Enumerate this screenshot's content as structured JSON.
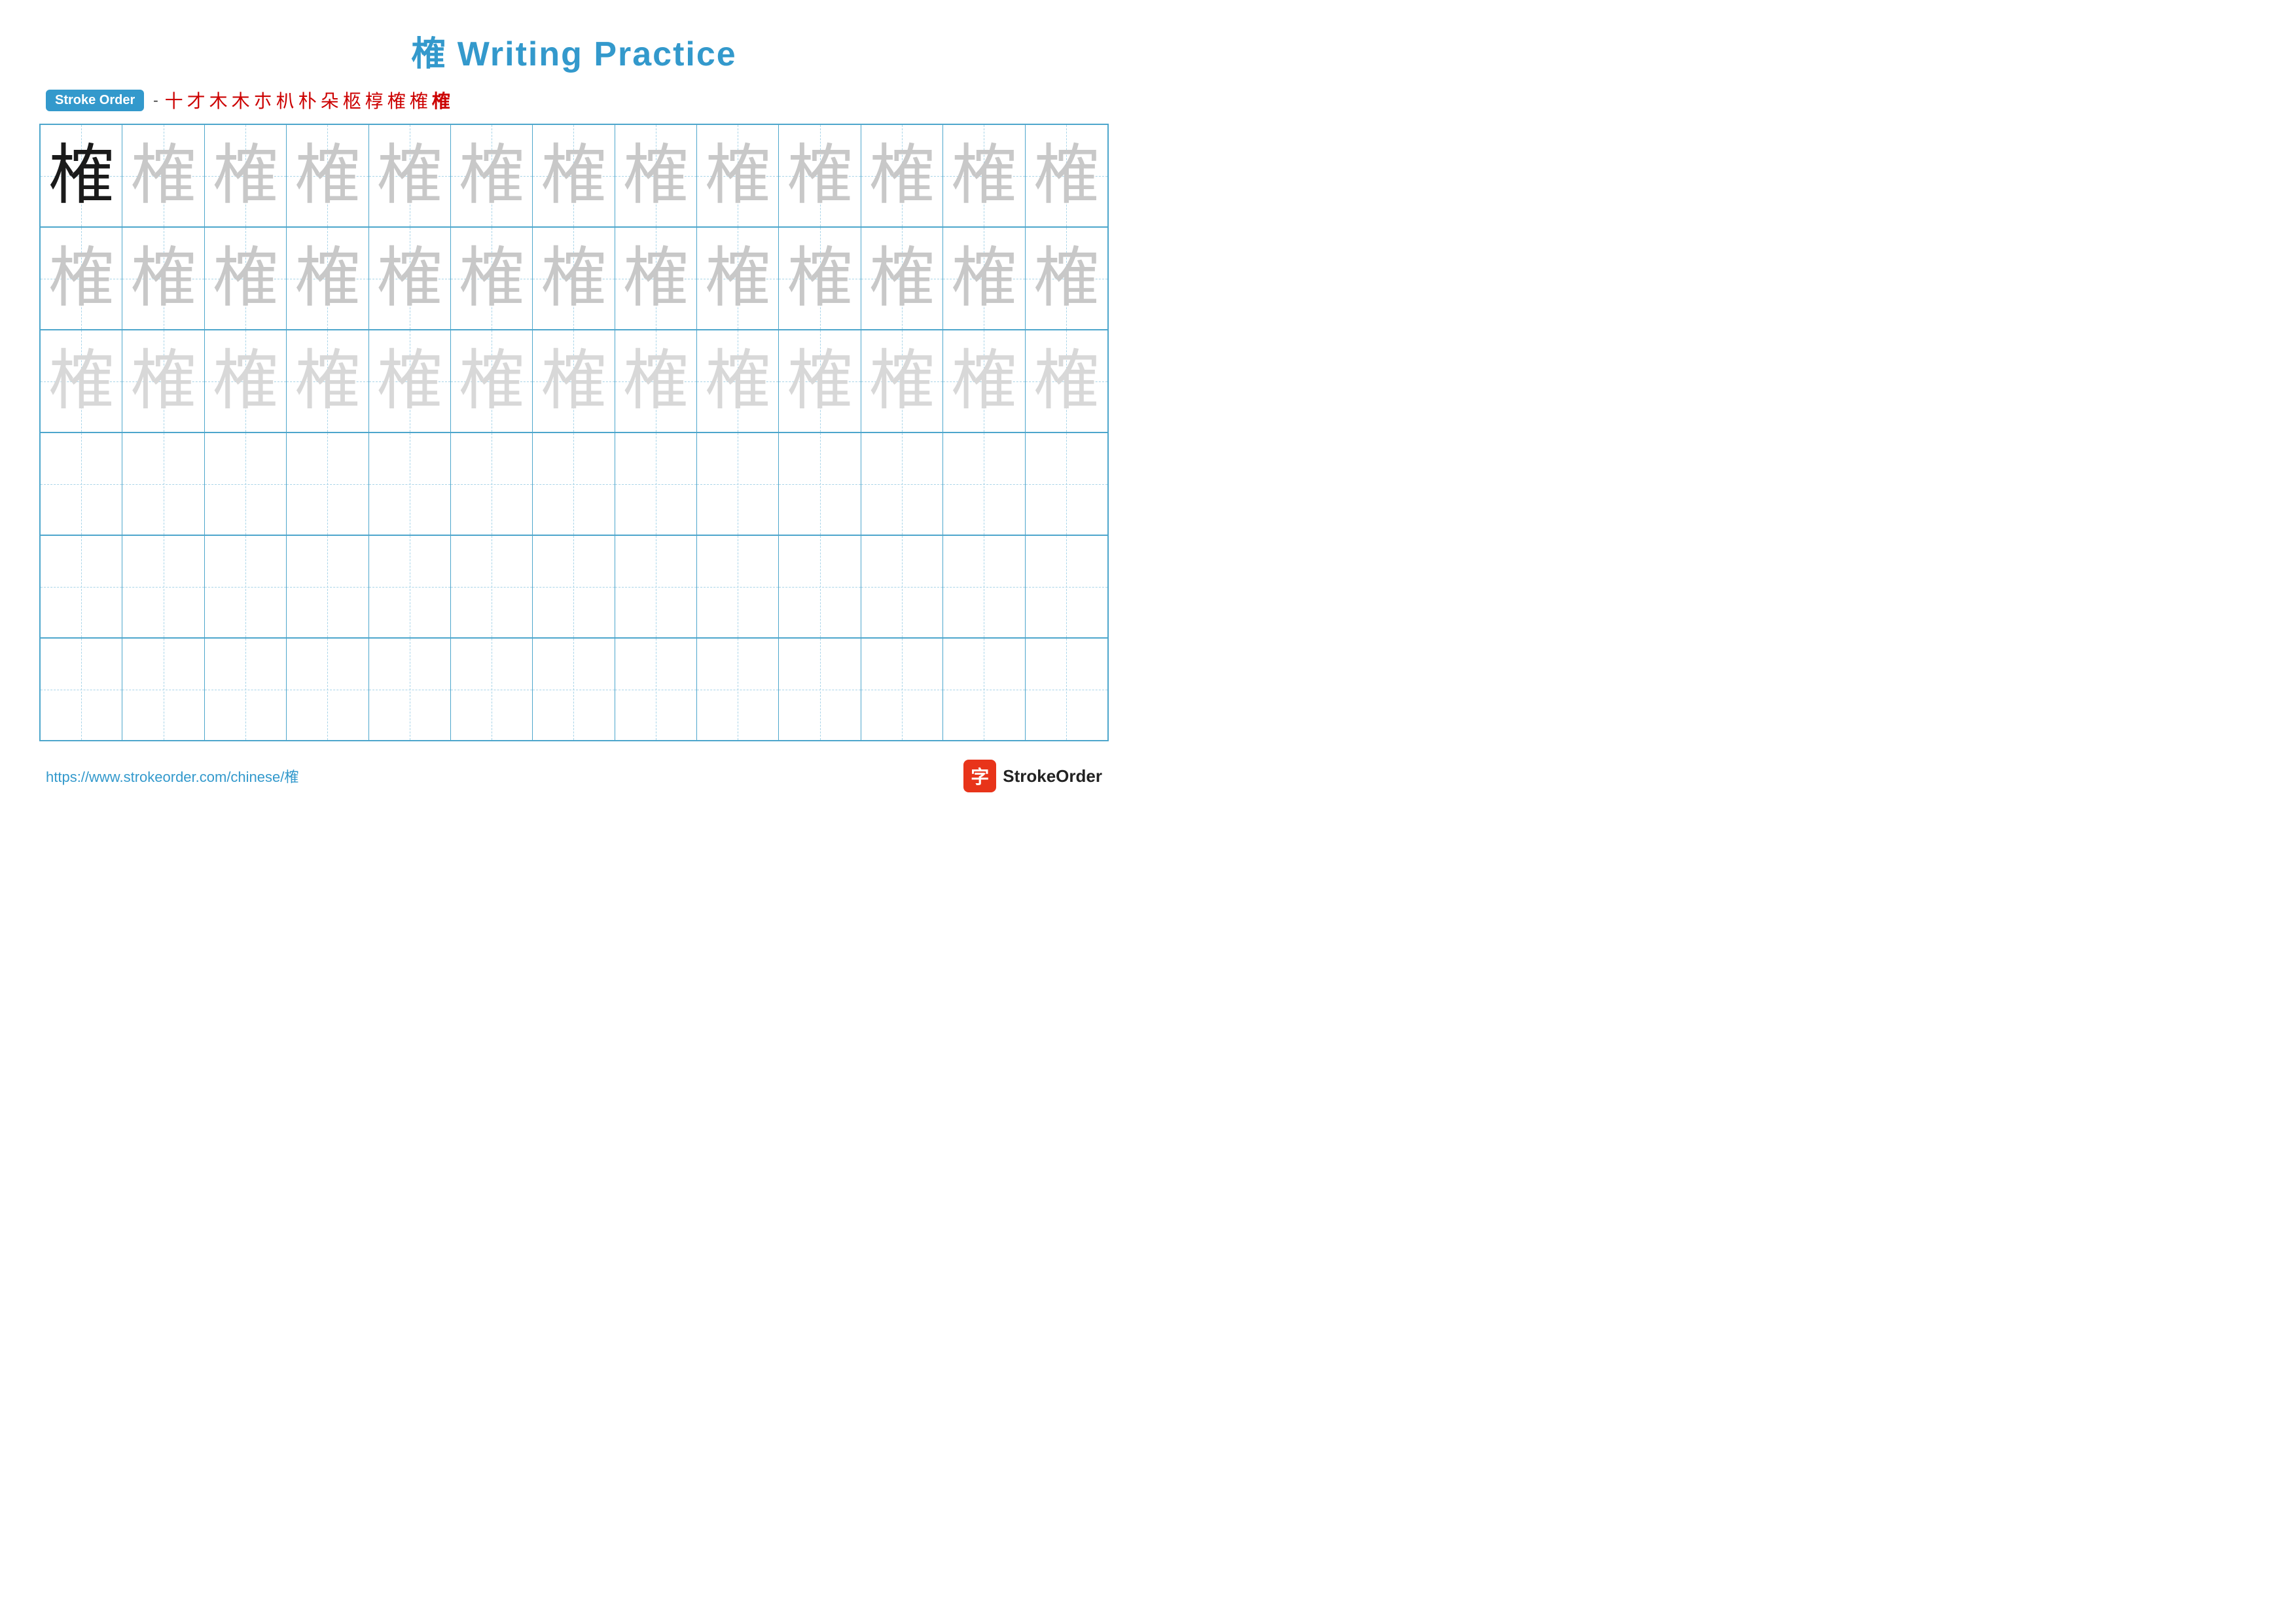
{
  "title": "榷 Writing Practice",
  "stroke_order": {
    "badge": "Stroke Order",
    "steps": [
      "一",
      "十",
      "才",
      "木",
      "木",
      "朩",
      "朳",
      "朴",
      "朵",
      "柩",
      "椁",
      "榷",
      "榷",
      "榷"
    ]
  },
  "grid": {
    "char": "榷",
    "rows": [
      {
        "type": "dark-then-light",
        "dark_count": 1,
        "light_shade": "light1",
        "total": 13
      },
      {
        "type": "all-light",
        "light_shade": "light1",
        "total": 13
      },
      {
        "type": "all-light",
        "light_shade": "light2",
        "total": 13
      },
      {
        "type": "empty",
        "total": 13
      },
      {
        "type": "empty",
        "total": 13
      },
      {
        "type": "empty",
        "total": 13
      }
    ]
  },
  "footer": {
    "url": "https://www.strokeorder.com/chinese/榷",
    "brand_char": "字",
    "brand_name": "StrokeOrder"
  }
}
